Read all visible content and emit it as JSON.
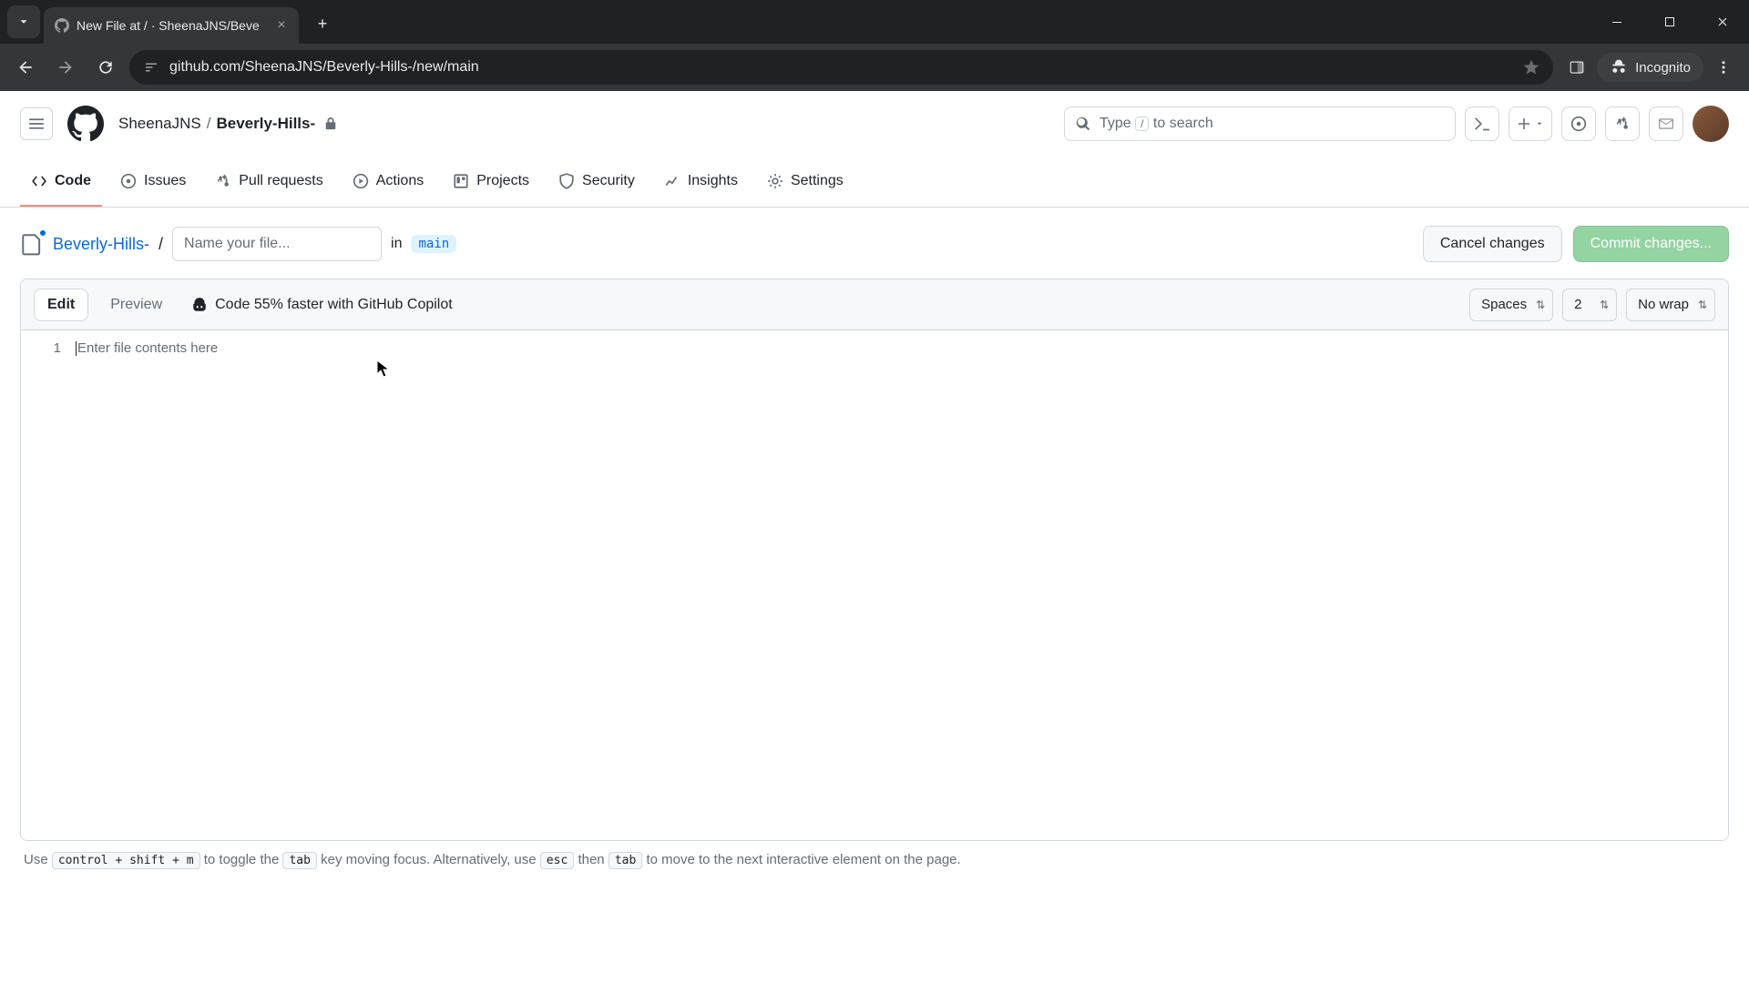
{
  "browser": {
    "tab_title": "New File at / · SheenaJNS/Beve",
    "url": "github.com/SheenaJNS/Beverly-Hills-/new/main",
    "incognito": "Incognito"
  },
  "header": {
    "owner": "SheenaJNS",
    "repo": "Beverly-Hills-",
    "search_prefix": "Type ",
    "search_key": "/",
    "search_suffix": " to search"
  },
  "repo_nav": {
    "code": "Code",
    "issues": "Issues",
    "pulls": "Pull requests",
    "actions": "Actions",
    "projects": "Projects",
    "security": "Security",
    "insights": "Insights",
    "settings": "Settings"
  },
  "editor": {
    "repo_link": "Beverly-Hills-",
    "filename_placeholder": "Name your file...",
    "in": "in",
    "branch": "main",
    "cancel": "Cancel changes",
    "commit": "Commit changes...",
    "edit_tab": "Edit",
    "preview_tab": "Preview",
    "copilot": "Code 55% faster with GitHub Copilot",
    "indent_mode": "Spaces",
    "indent_size": "2",
    "wrap": "No wrap",
    "line1_no": "1",
    "placeholder": "Enter file contents here"
  },
  "footer": {
    "t1": "Use ",
    "k1": "control + shift + m",
    "t2": " to toggle the ",
    "k2": "tab",
    "t3": " key moving focus. Alternatively, use ",
    "k3": "esc",
    "t4": " then ",
    "k4": "tab",
    "t5": " to move to the next interactive element on the page."
  }
}
